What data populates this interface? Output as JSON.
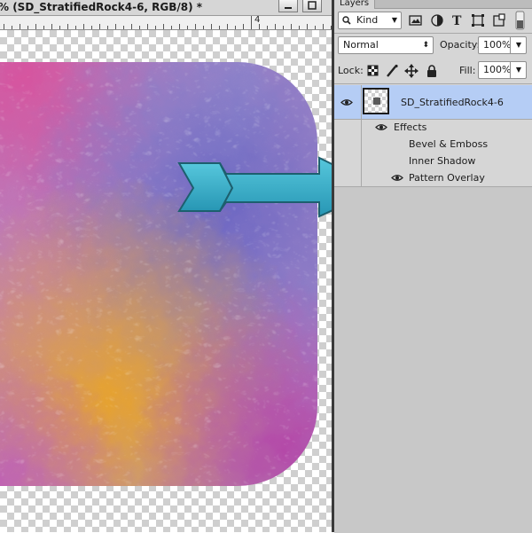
{
  "document": {
    "title": "% (SD_StratifiedRock4-6, RGB/8) *",
    "ruler_label": "4"
  },
  "panel": {
    "tab_label": "Layers",
    "filter": {
      "kind_label": "Kind"
    },
    "blend_mode": "Normal",
    "opacity_label": "Opacity:",
    "opacity_value": "100%",
    "lock_label": "Lock:",
    "fill_label": "Fill:",
    "fill_value": "100%",
    "layer": {
      "name": "SD_StratifiedRock4-6",
      "effects_label": "Effects",
      "effects": [
        {
          "label": "Bevel & Emboss"
        },
        {
          "label": "Inner Shadow"
        },
        {
          "label": "Pattern Overlay"
        }
      ]
    }
  },
  "colors": {
    "selection": "#b5cdf5",
    "arrow": "#3aaec7",
    "panel_bg": "#d6d6d6"
  }
}
